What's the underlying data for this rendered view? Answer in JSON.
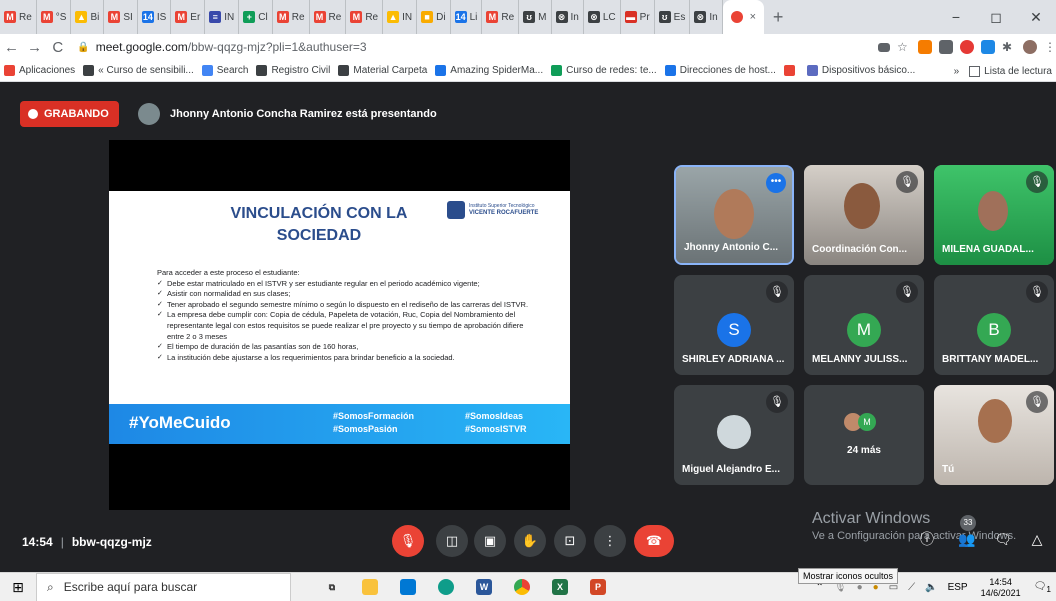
{
  "browser": {
    "tabs": [
      {
        "label": "Re",
        "color": "#ea4335",
        "glyph": "M"
      },
      {
        "label": "°S",
        "color": "#ea4335",
        "glyph": "M"
      },
      {
        "label": "Bi",
        "color": "#fbbc04",
        "glyph": "▲"
      },
      {
        "label": "SI",
        "color": "#ea4335",
        "glyph": "M"
      },
      {
        "label": "IS",
        "color": "#1a73e8",
        "glyph": "14"
      },
      {
        "label": "Er",
        "color": "#ea4335",
        "glyph": "M"
      },
      {
        "label": "IN",
        "color": "#3949ab",
        "glyph": "≡"
      },
      {
        "label": "Cl",
        "color": "#0f9d58",
        "glyph": "+"
      },
      {
        "label": "Re",
        "color": "#ea4335",
        "glyph": "M"
      },
      {
        "label": "Re",
        "color": "#ea4335",
        "glyph": "M"
      },
      {
        "label": "Re",
        "color": "#ea4335",
        "glyph": "M"
      },
      {
        "label": "IN",
        "color": "#fbbc04",
        "glyph": "▲"
      },
      {
        "label": "Di",
        "color": "#f9ab00",
        "glyph": "■"
      },
      {
        "label": "Li",
        "color": "#1a73e8",
        "glyph": "14"
      },
      {
        "label": "Re",
        "color": "#ea4335",
        "glyph": "M"
      },
      {
        "label": "M",
        "color": "#3c4043",
        "glyph": "ʊ"
      },
      {
        "label": "In",
        "color": "#3c4043",
        "glyph": "⊗"
      },
      {
        "label": "LC",
        "color": "#3c4043",
        "glyph": "⊗"
      },
      {
        "label": "Pr",
        "color": "#d93025",
        "glyph": "▬"
      },
      {
        "label": "Es",
        "color": "#3c4043",
        "glyph": "ʊ"
      },
      {
        "label": "In",
        "color": "#3c4043",
        "glyph": "⊗"
      }
    ],
    "active_tab_close": "×",
    "new_tab": "+",
    "window_controls": {
      "minimize": "−",
      "maximize": "◻",
      "close": "✕"
    },
    "url_host": "meet.google.com",
    "url_path": "/bbw-qqzg-mjz?pli=1&authuser=3",
    "bookmarks": [
      {
        "label": "Aplicaciones",
        "color": "#ea4335"
      },
      {
        "label": "« Curso de sensibili...",
        "color": "#3c4043"
      },
      {
        "label": "Search",
        "color": "#4285f4"
      },
      {
        "label": "Registro Civil",
        "color": "#3c4043"
      },
      {
        "label": "Material Carpeta",
        "color": "#3c4043"
      },
      {
        "label": "Amazing SpiderMa...",
        "color": "#1a73e8"
      },
      {
        "label": "Curso de redes: te...",
        "color": "#0f9d58"
      },
      {
        "label": "Direcciones de host...",
        "color": "#1a73e8"
      },
      {
        "label": "",
        "color": "#ea4335"
      },
      {
        "label": "Dispositivos básico...",
        "color": "#5c6bc0"
      }
    ],
    "bookmarks_overflow": "»",
    "reading_list": "Lista de lectura"
  },
  "meet": {
    "recording_label": "GRABANDO",
    "presenter_text": "Jhonny Antonio Concha Ramirez está presentando",
    "slide": {
      "title_line1": "VINCULACIÓN CON LA",
      "title_line2": "SOCIEDAD",
      "logo_line1": "Instituto Superior Tecnológico",
      "logo_line2": "VICENTE ROCAFUERTE",
      "intro": "Para acceder a este proceso el estudiante:",
      "bullets": [
        "Debe estar matriculado en el ISTVR y ser estudiante regular en el periodo académico vigente;",
        "Asistir con normalidad en sus clases;",
        "Tener aprobado el segundo semestre mínimo o según lo dispuesto en el rediseño de las carreras del ISTVR.",
        "La empresa debe cumplir con: Copia de cédula, Papeleta de votación, Ruc, Copia del Nombramiento del representante legal con estos requisitos se puede realizar el pre proyecto y su tiempo de aprobación difiere entre 2 o 3 meses",
        "El tiempo de duración de las pasantías son de 160 horas,",
        "La institución debe ajustarse a los requerimientos para brindar beneficio a la sociedad."
      ],
      "banner_main": "#YoMeCuido",
      "banner_tag1": "#SomosFormación",
      "banner_tag2": "#SomosPasión",
      "banner_tag3": "#SomosIdeas",
      "banner_tag4": "#SomosISTVR"
    },
    "participants": [
      {
        "name": "Jhonny Antonio C...",
        "type": "video"
      },
      {
        "name": "Coordinación Con...",
        "type": "video"
      },
      {
        "name": "MILENA GUADAL...",
        "type": "video"
      },
      {
        "name": "SHIRLEY ADRIANA ...",
        "initial": "S",
        "color": "#1a73e8"
      },
      {
        "name": "MELANNY JULISS...",
        "initial": "M",
        "color": "#34a853"
      },
      {
        "name": "BRITTANY MADEL...",
        "initial": "B",
        "color": "#34a853"
      },
      {
        "name": "Miguel Alejandro E...",
        "type": "photo"
      },
      {
        "name": "24 más",
        "type": "more",
        "initial": "M"
      },
      {
        "name": "Tú",
        "type": "video"
      }
    ],
    "time": "14:54",
    "meeting_code": "bbw-qqzg-mjz",
    "activate_title": "Activar Windows",
    "activate_sub": "Ve a Configuración para activar Windows.",
    "people_count": "33"
  },
  "taskbar": {
    "search_placeholder": "Escribe aquí para buscar",
    "tooltip": "Mostrar iconos ocultos",
    "lang": "ESP",
    "time": "14:54",
    "date": "14/6/2021",
    "notification_count": "1"
  }
}
